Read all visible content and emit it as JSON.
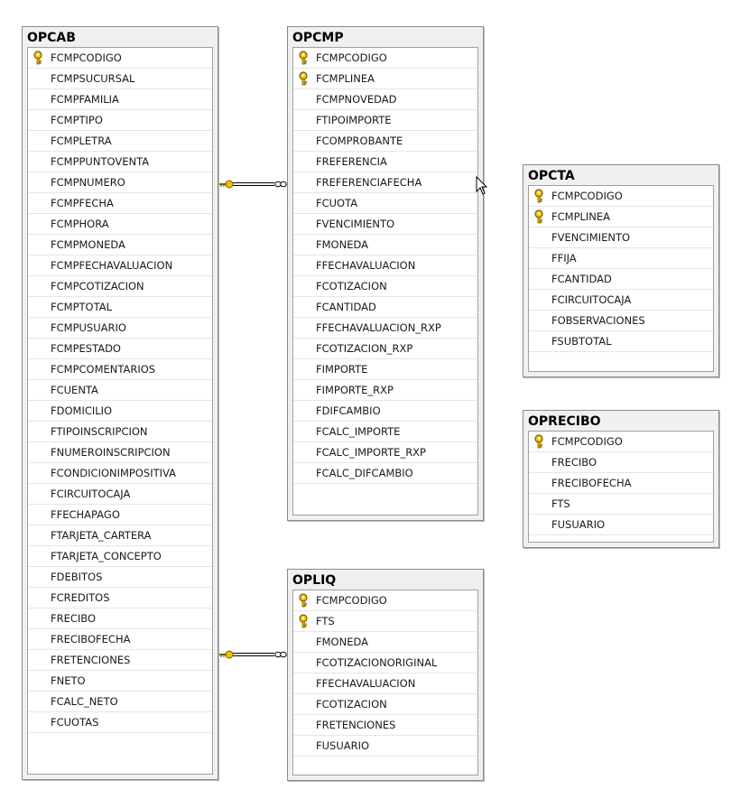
{
  "tables": [
    {
      "id": "opcab",
      "title": "OPCAB",
      "columns": [
        {
          "name": "FCMPCODIGO",
          "key": true
        },
        {
          "name": "FCMPSUCURSAL"
        },
        {
          "name": "FCMPFAMILIA"
        },
        {
          "name": "FCMPTIPO"
        },
        {
          "name": "FCMPLETRA"
        },
        {
          "name": "FCMPPUNTOVENTA"
        },
        {
          "name": "FCMPNUMERO"
        },
        {
          "name": "FCMPFECHA"
        },
        {
          "name": "FCMPHORA"
        },
        {
          "name": "FCMPMONEDA"
        },
        {
          "name": "FCMPFECHAVALUACION"
        },
        {
          "name": "FCMPCOTIZACION"
        },
        {
          "name": "FCMPTOTAL"
        },
        {
          "name": "FCMPUSUARIO"
        },
        {
          "name": "FCMPESTADO"
        },
        {
          "name": "FCMPCOMENTARIOS"
        },
        {
          "name": "FCUENTA"
        },
        {
          "name": "FDOMICILIO"
        },
        {
          "name": "FTIPOINSCRIPCION"
        },
        {
          "name": "FNUMEROINSCRIPCION"
        },
        {
          "name": "FCONDICIONIMPOSITIVA"
        },
        {
          "name": "FCIRCUITOCAJA"
        },
        {
          "name": "FFECHAPAGO"
        },
        {
          "name": "FTARJETA_CARTERA"
        },
        {
          "name": "FTARJETA_CONCEPTO"
        },
        {
          "name": "FDEBITOS"
        },
        {
          "name": "FCREDITOS"
        },
        {
          "name": "FRECIBO"
        },
        {
          "name": "FRECIBOFECHA"
        },
        {
          "name": "FRETENCIONES"
        },
        {
          "name": "FNETO"
        },
        {
          "name": "FCALC_NETO"
        },
        {
          "name": "FCUOTAS"
        }
      ]
    },
    {
      "id": "opcmp",
      "title": "OPCMP",
      "columns": [
        {
          "name": "FCMPCODIGO",
          "key": true
        },
        {
          "name": "FCMPLINEA",
          "key": true
        },
        {
          "name": "FCMPNOVEDAD"
        },
        {
          "name": "FTIPOIMPORTE"
        },
        {
          "name": "FCOMPROBANTE"
        },
        {
          "name": "FREFERENCIA"
        },
        {
          "name": "FREFERENCIAFECHA"
        },
        {
          "name": "FCUOTA"
        },
        {
          "name": "FVENCIMIENTO"
        },
        {
          "name": "FMONEDA"
        },
        {
          "name": "FFECHAVALUACION"
        },
        {
          "name": "FCOTIZACION"
        },
        {
          "name": "FCANTIDAD"
        },
        {
          "name": "FFECHAVALUACION_RXP"
        },
        {
          "name": "FCOTIZACION_RXP"
        },
        {
          "name": "FIMPORTE"
        },
        {
          "name": "FIMPORTE_RXP"
        },
        {
          "name": "FDIFCAMBIO"
        },
        {
          "name": "FCALC_IMPORTE"
        },
        {
          "name": "FCALC_IMPORTE_RXP"
        },
        {
          "name": "FCALC_DIFCAMBIO"
        }
      ]
    },
    {
      "id": "opcta",
      "title": "OPCTA",
      "columns": [
        {
          "name": "FCMPCODIGO",
          "key": true
        },
        {
          "name": "FCMPLINEA",
          "key": true
        },
        {
          "name": "FVENCIMIENTO"
        },
        {
          "name": "FFIJA"
        },
        {
          "name": "FCANTIDAD"
        },
        {
          "name": "FCIRCUITOCAJA"
        },
        {
          "name": "FOBSERVACIONES"
        },
        {
          "name": "FSUBTOTAL"
        }
      ]
    },
    {
      "id": "oprecibo",
      "title": "OPRECIBO",
      "columns": [
        {
          "name": "FCMPCODIGO",
          "key": true
        },
        {
          "name": "FRECIBO"
        },
        {
          "name": "FRECIBOFECHA"
        },
        {
          "name": "FTS"
        },
        {
          "name": "FUSUARIO"
        }
      ]
    },
    {
      "id": "opliq",
      "title": "OPLIQ",
      "columns": [
        {
          "name": "FCMPCODIGO",
          "key": true
        },
        {
          "name": "FTS",
          "key": true
        },
        {
          "name": "FMONEDA"
        },
        {
          "name": "FCOTIZACIONORIGINAL"
        },
        {
          "name": "FFECHAVALUACION"
        },
        {
          "name": "FCOTIZACION"
        },
        {
          "name": "FRETENCIONES"
        },
        {
          "name": "FUSUARIO"
        }
      ]
    }
  ],
  "relationships": [
    {
      "from": "opcab",
      "to": "opcmp"
    },
    {
      "from": "opcab",
      "to": "opliq"
    }
  ],
  "colors": {
    "key_fill": "#f2c200",
    "key_stroke": "#7a5c00",
    "link": "#000000"
  }
}
